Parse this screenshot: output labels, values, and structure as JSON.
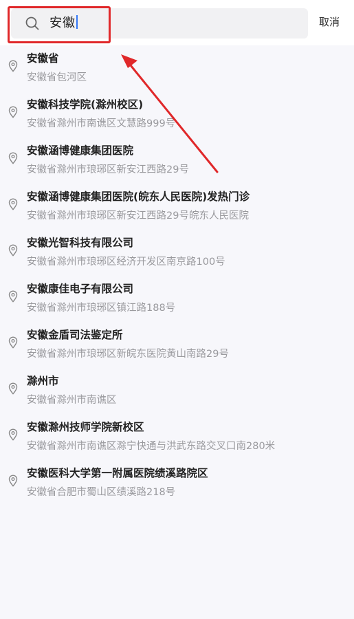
{
  "search": {
    "query": "安徽",
    "cancel_label": "取消"
  },
  "results": [
    {
      "name": "安徽省",
      "address": "安徽省包河区"
    },
    {
      "name": "安徽科技学院(滁州校区)",
      "address": "安徽省滁州市南谯区文慧路999号"
    },
    {
      "name": "安徽涵博健康集团医院",
      "address": "安徽省滁州市琅琊区新安江西路29号"
    },
    {
      "name": "安徽涵博健康集团医院(皖东人民医院)发热门诊",
      "address": "安徽省滁州市琅琊区新安江西路29号皖东人民医院"
    },
    {
      "name": "安徽光智科技有限公司",
      "address": "安徽省滁州市琅琊区经济开发区南京路100号"
    },
    {
      "name": "安徽康佳电子有限公司",
      "address": "安徽省滁州市琅琊区镇江路188号"
    },
    {
      "name": "安徽金盾司法鉴定所",
      "address": "安徽省滁州市琅琊区新皖东医院黄山南路29号"
    },
    {
      "name": "滁州市",
      "address": "安徽省滁州市南谯区"
    },
    {
      "name": "安徽滁州技师学院新校区",
      "address": "安徽省滁州市南谯区滁宁快通与洪武东路交叉口南280米"
    },
    {
      "name": "安徽医科大学第一附属医院绩溪路院区",
      "address": "安徽省合肥市蜀山区绩溪路218号"
    }
  ],
  "icons": {
    "search": "search-icon",
    "pin": "location-pin-icon"
  },
  "colors": {
    "annotation": "#e0282a",
    "caret": "#3478f6"
  }
}
